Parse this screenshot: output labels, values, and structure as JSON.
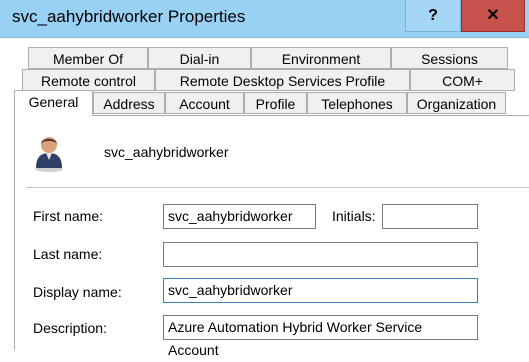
{
  "window": {
    "title": "svc_aahybridworker Properties",
    "help_label": "?",
    "close_label": "✕"
  },
  "tabs": {
    "row1": [
      "Member Of",
      "Dial-in",
      "Environment",
      "Sessions"
    ],
    "row2": [
      "Remote control",
      "Remote Desktop Services Profile",
      "COM+"
    ],
    "row3": [
      "General",
      "Address",
      "Account",
      "Profile",
      "Telephones",
      "Organization"
    ],
    "active": "General"
  },
  "user": {
    "name": "svc_aahybridworker",
    "icon": "user-icon"
  },
  "form": {
    "first_name_label": "First name:",
    "first_name": "svc_aahybridworker",
    "initials_label": "Initials:",
    "initials": "",
    "last_name_label": "Last name:",
    "last_name": "",
    "display_name_label": "Display name:",
    "display_name": "svc_aahybridworker",
    "description_label": "Description:",
    "description": "Azure Automation Hybrid Worker Service Account"
  }
}
